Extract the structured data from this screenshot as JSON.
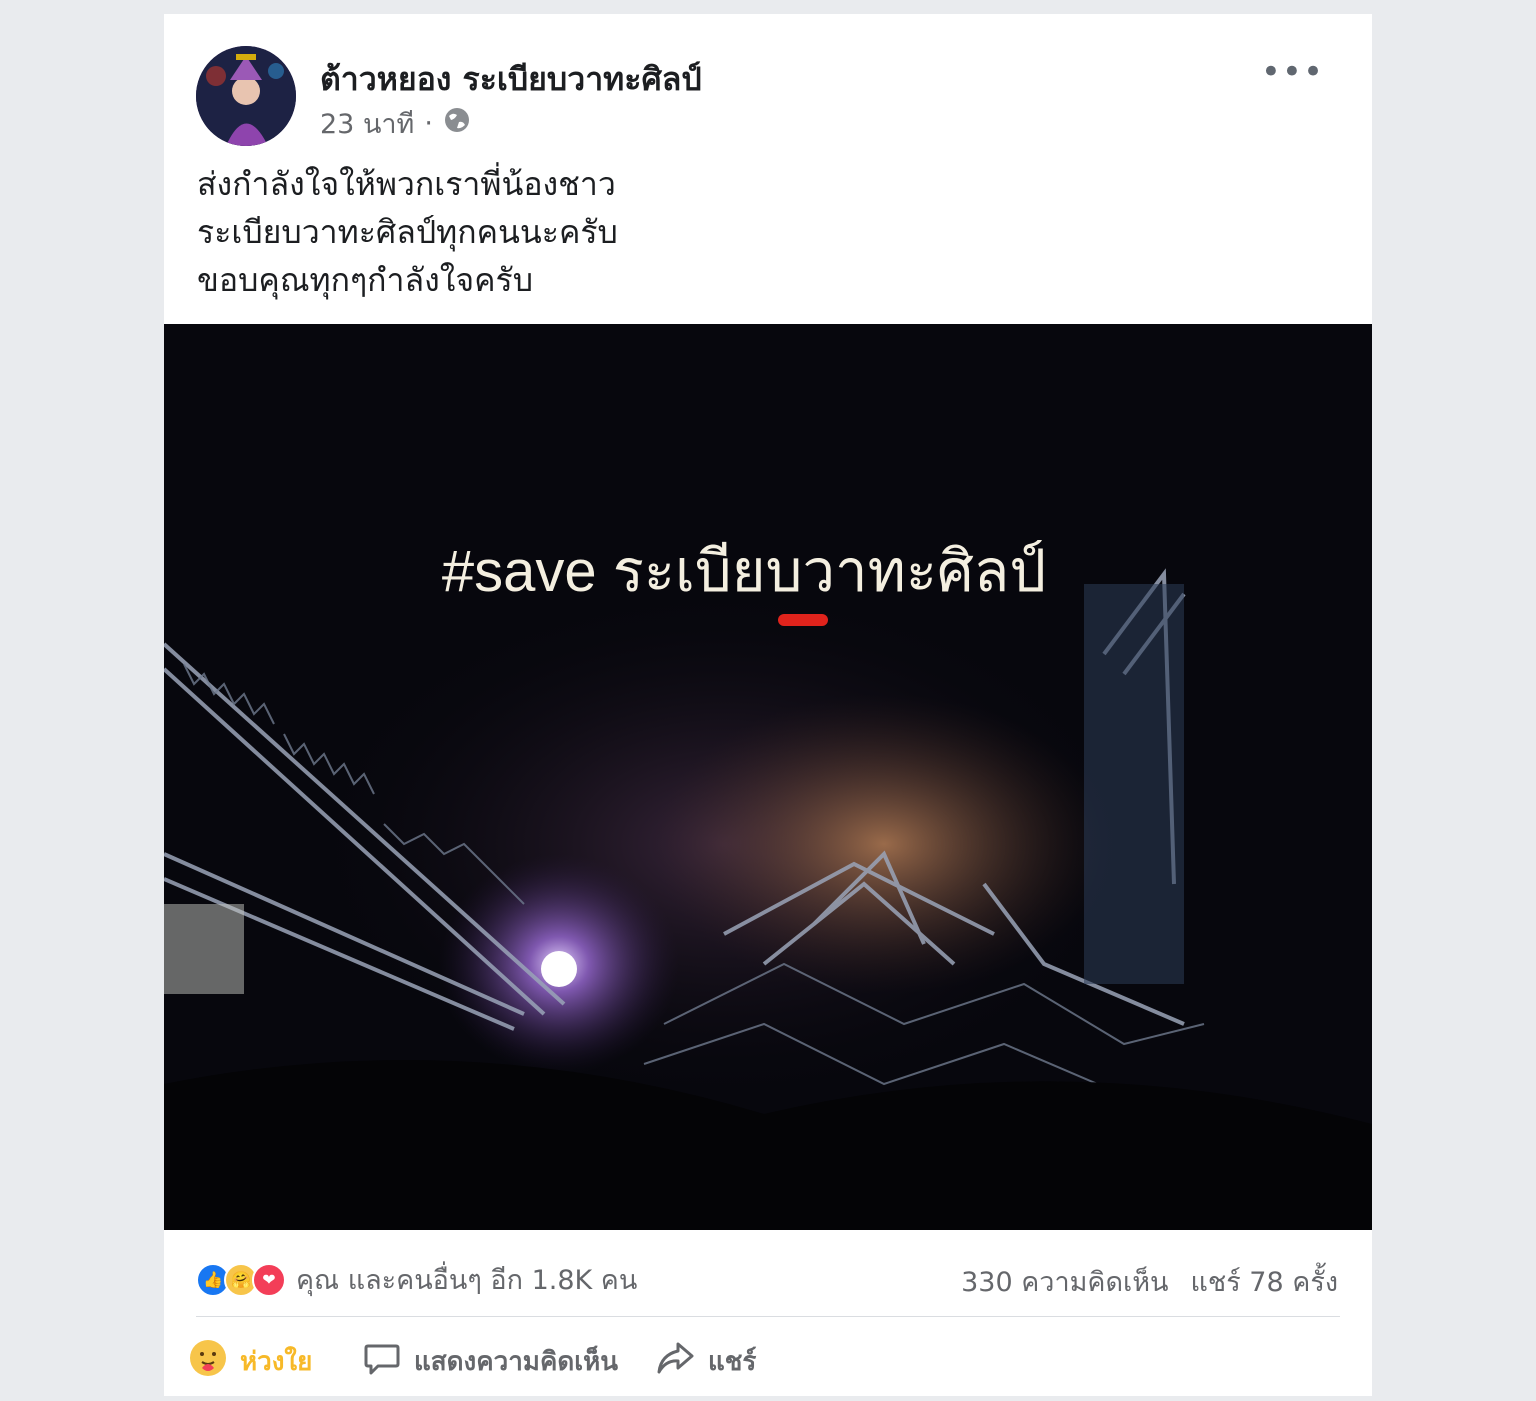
{
  "post": {
    "author": "ต้าวหยอง ระเบียบวาทะศิลป์",
    "time": "23 นาที",
    "separator": "·",
    "privacy_icon": "globe-icon",
    "more_label": "•••",
    "text_lines": [
      "ส่งกำลังใจให้พวกเราพี่น้องชาว",
      "ระเบียบวาทะศิลป์ทุกคนนะครับ",
      "ขอบคุณทุกๆกำลังใจครับ"
    ],
    "photo_caption": "#save ระเบียบวาทะศิลป์"
  },
  "stats": {
    "reactions_text": "คุณ และคนอื่นๆ อีก 1.8K คน",
    "comments": "330 ความคิดเห็น",
    "shares": "แชร์ 78 ครั้ง"
  },
  "actions": {
    "care_label": "ห่วงใย",
    "comment_label": "แสดงความคิดเห็น",
    "share_label": "แชร์"
  },
  "colors": {
    "like": "#1877f2",
    "care": "#f7c54a",
    "love": "#f33e58",
    "care_active_text": "#f7b928"
  }
}
